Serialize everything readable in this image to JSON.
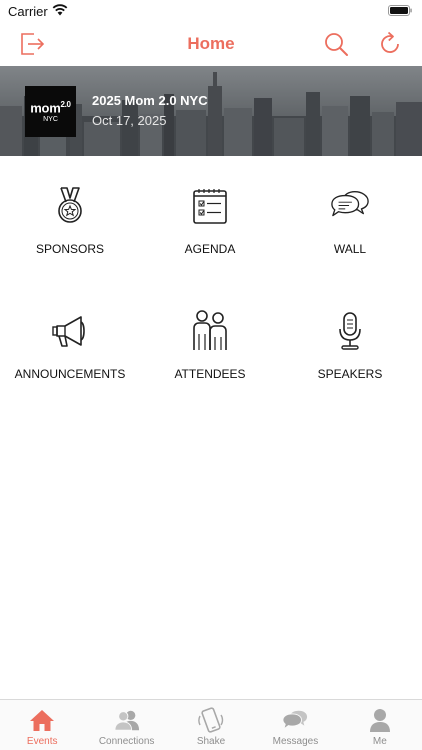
{
  "status_bar": {
    "carrier": "Carrier"
  },
  "nav": {
    "title": "Home",
    "accent_color": "#ec6e5e"
  },
  "event": {
    "name": "2025 Mom 2.0 NYC",
    "date": "Oct 17, 2025",
    "logo_main": "mom",
    "logo_version": "2.0",
    "logo_sub": "NYC"
  },
  "menu": [
    {
      "label": "SPONSORS",
      "icon": "medal-icon"
    },
    {
      "label": "AGENDA",
      "icon": "checklist-calendar-icon"
    },
    {
      "label": "WALL",
      "icon": "chat-bubbles-icon"
    },
    {
      "label": "ANNOUNCEMENTS",
      "icon": "megaphone-icon"
    },
    {
      "label": "ATTENDEES",
      "icon": "people-icon"
    },
    {
      "label": "SPEAKERS",
      "icon": "microphone-icon"
    }
  ],
  "tabs": [
    {
      "label": "Events",
      "icon": "home-icon",
      "active": true
    },
    {
      "label": "Connections",
      "icon": "people-icon",
      "active": false
    },
    {
      "label": "Shake",
      "icon": "shake-phone-icon",
      "active": false
    },
    {
      "label": "Messages",
      "icon": "chat-icon",
      "active": false
    },
    {
      "label": "Me",
      "icon": "person-icon",
      "active": false
    }
  ]
}
